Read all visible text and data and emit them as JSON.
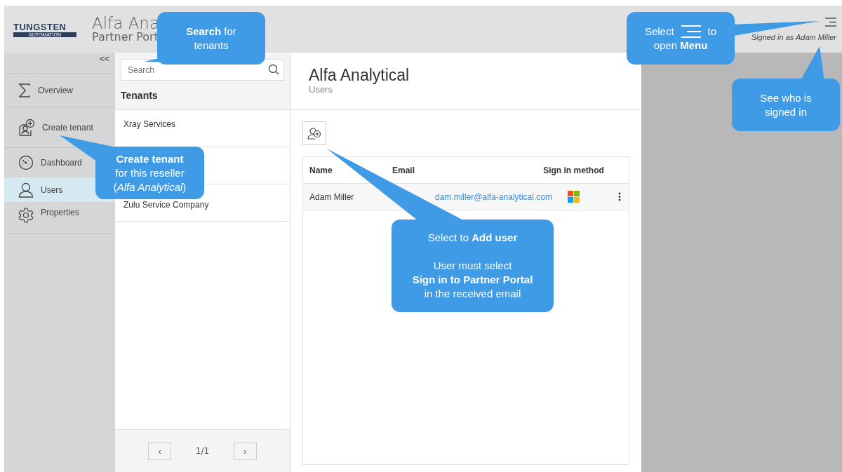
{
  "header": {
    "logo_top": "TUNGSTEN",
    "logo_bottom": "AUTOMATION",
    "title": "Alfa Ana",
    "subtitle": "Partner Port",
    "signed_in": "Signed in as Adam Miller"
  },
  "sidebar": {
    "collapse": "<<",
    "items": [
      {
        "label": "Overview",
        "kind": "sigma",
        "selected": false
      },
      {
        "label": "Create tenant",
        "kind": "add-person",
        "selected": false
      },
      {
        "label": "Dashboard",
        "kind": "gauge",
        "selected": false
      },
      {
        "label": "Users",
        "kind": "person",
        "selected": true
      },
      {
        "label": "Properties",
        "kind": "gear",
        "selected": false
      }
    ]
  },
  "tenants": {
    "search": {
      "placeholder": "Search"
    },
    "heading": "Tenants",
    "rows": [
      {
        "name": "Xray Services"
      },
      {
        "name": "Zulu Service Company"
      }
    ],
    "pager": {
      "prev": "‹",
      "page": "1/1",
      "next": "›"
    }
  },
  "main": {
    "title": "Alfa Analytical",
    "subtitle": "Users",
    "table": {
      "columns": [
        "Name",
        "Email",
        "Sign in method"
      ],
      "rows": [
        {
          "name": "Adam Miller",
          "email": "dam.miller@alfa-analytical.com"
        }
      ]
    }
  },
  "callouts": [
    {
      "kind": "text",
      "paragraphs": [
        [
          "**Search** for",
          "tenants"
        ]
      ]
    },
    {
      "kind": "text",
      "paragraphs": [
        [
          "**Create tenant**",
          "for this reseller",
          "(*Alfa Analytical*)"
        ]
      ]
    },
    {
      "kind": "menu",
      "before": "Select",
      "after": "to",
      "paragraphs": [
        [
          "open **Menu**"
        ]
      ]
    },
    {
      "kind": "text",
      "paragraphs": [
        [
          "See who is",
          "signed in"
        ]
      ]
    },
    {
      "kind": "text",
      "paragraphs": [
        [
          "Select to **Add user**"
        ],
        [
          "User must select",
          "**Sign in to Partner Portal**",
          "in the received email"
        ]
      ]
    }
  ]
}
